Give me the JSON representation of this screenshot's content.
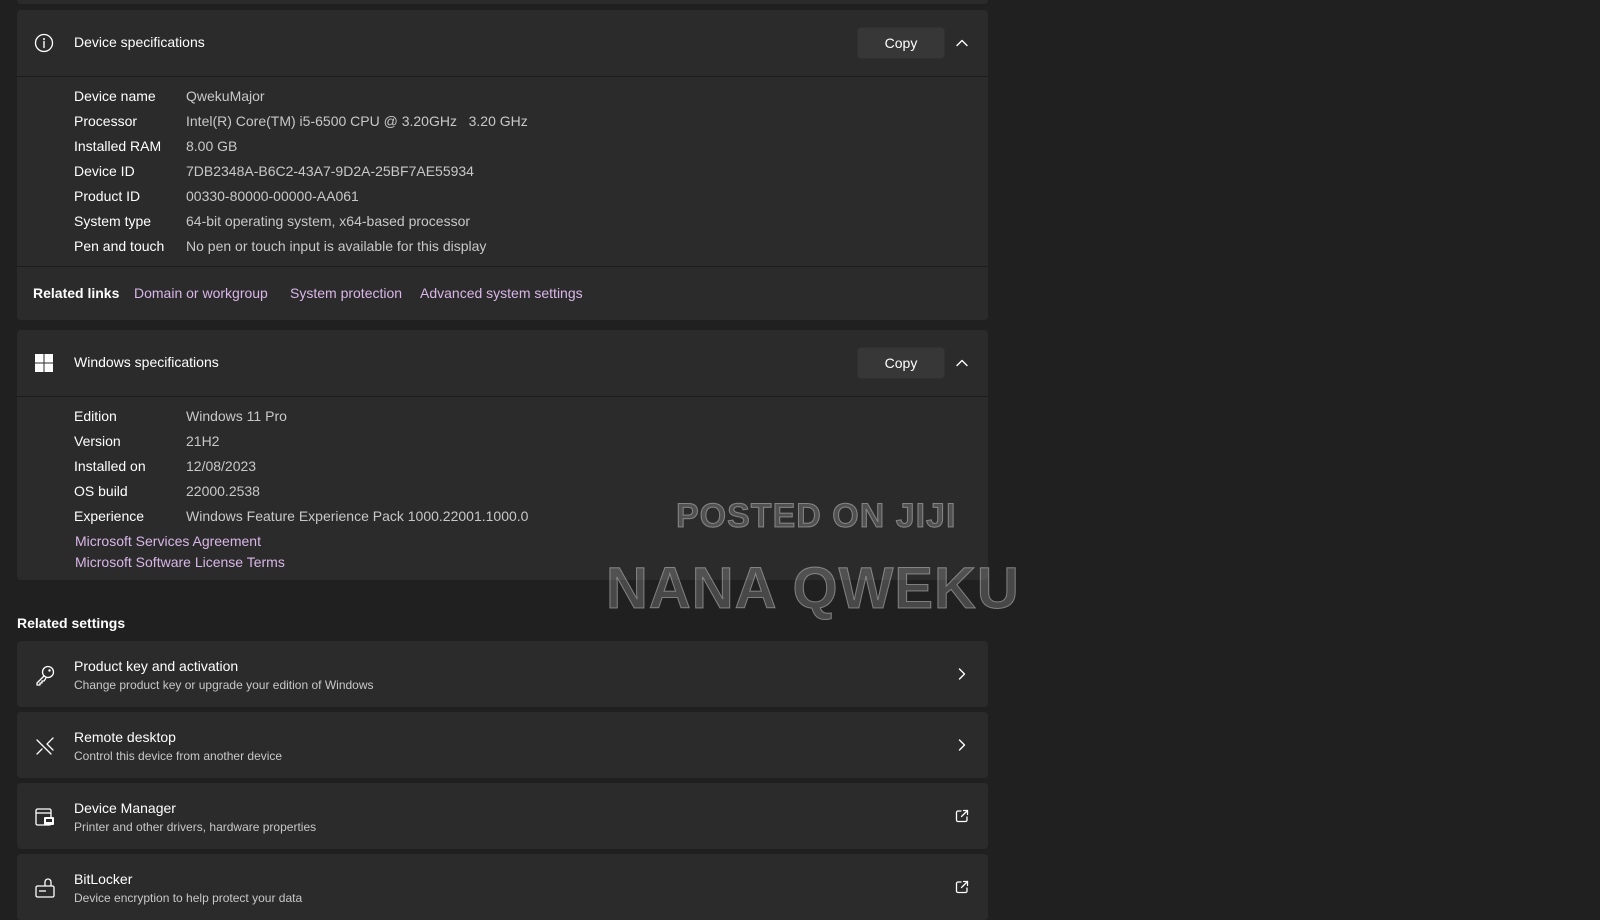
{
  "device_specs": {
    "title": "Device specifications",
    "copy_label": "Copy",
    "rows": [
      {
        "label": "Device name",
        "value": "QwekuMajor"
      },
      {
        "label": "Processor",
        "value": "Intel(R) Core(TM) i5-6500 CPU @ 3.20GHz   3.20 GHz"
      },
      {
        "label": "Installed RAM",
        "value": "8.00 GB"
      },
      {
        "label": "Device ID",
        "value": "7DB2348A-B6C2-43A7-9D2A-25BF7AE55934"
      },
      {
        "label": "Product ID",
        "value": "00330-80000-00000-AA061"
      },
      {
        "label": "System type",
        "value": "64-bit operating system, x64-based processor"
      },
      {
        "label": "Pen and touch",
        "value": "No pen or touch input is available for this display"
      }
    ]
  },
  "related_links": {
    "title": "Related links",
    "links": [
      "Domain or workgroup",
      "System protection",
      "Advanced system settings"
    ]
  },
  "windows_specs": {
    "title": "Windows specifications",
    "copy_label": "Copy",
    "rows": [
      {
        "label": "Edition",
        "value": "Windows 11 Pro"
      },
      {
        "label": "Version",
        "value": "21H2"
      },
      {
        "label": "Installed on",
        "value": "12/08/2023"
      },
      {
        "label": "OS build",
        "value": "22000.2538"
      },
      {
        "label": "Experience",
        "value": "Windows Feature Experience Pack 1000.22001.1000.0"
      }
    ],
    "links": [
      "Microsoft Services Agreement",
      "Microsoft Software License Terms"
    ]
  },
  "related_settings": {
    "title": "Related settings",
    "items": [
      {
        "title": "Product key and activation",
        "desc": "Change product key or upgrade your edition of Windows",
        "icon": "key-icon",
        "action": "chevron-right-icon"
      },
      {
        "title": "Remote desktop",
        "desc": "Control this device from another device",
        "icon": "remote-desktop-icon",
        "action": "chevron-right-icon"
      },
      {
        "title": "Device Manager",
        "desc": "Printer and other drivers, hardware properties",
        "icon": "device-manager-icon",
        "action": "open-external-icon"
      },
      {
        "title": "BitLocker",
        "desc": "Device encryption to help protect your data",
        "icon": "bitlocker-icon",
        "action": "open-external-icon"
      }
    ]
  },
  "watermark": {
    "line1": "POSTED ON JIJI",
    "line2": "NANA QWEKU"
  },
  "colors": {
    "background": "#202020",
    "card": "#2b2b2b",
    "link": "#d9b6e8",
    "secondary_text": "#c8c8c8"
  }
}
